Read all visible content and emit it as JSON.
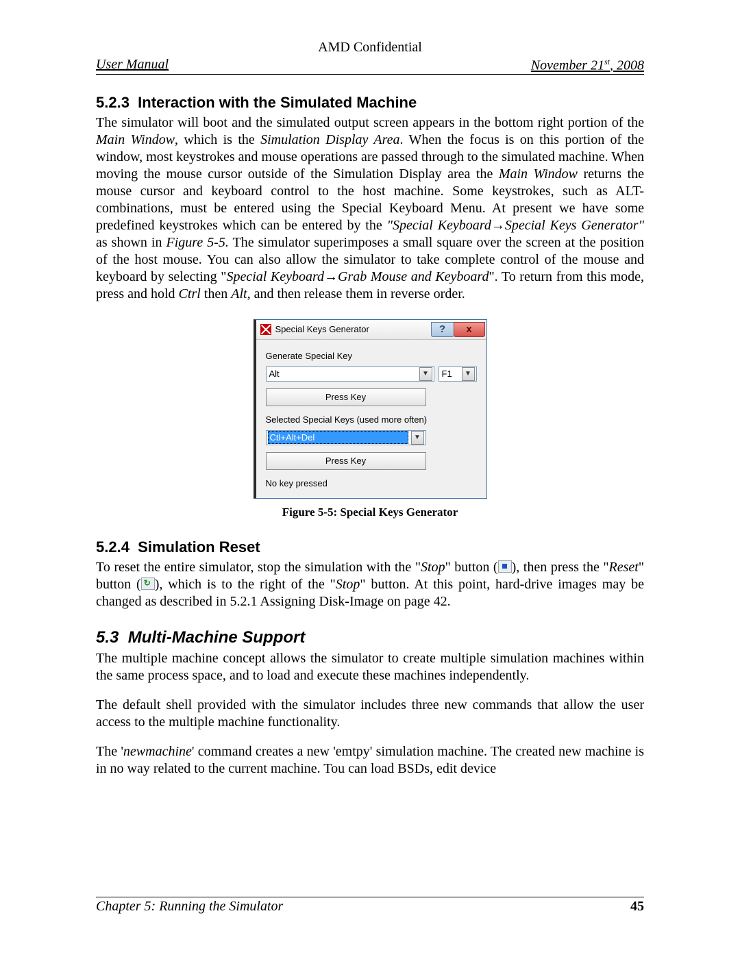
{
  "header": {
    "confidential": "AMD Confidential",
    "left": "User Manual",
    "right_prefix": "November 21",
    "right_sup": "st",
    "right_suffix": ", 2008"
  },
  "sec523": {
    "num": "5.2.3",
    "title": "Interaction with the Simulated Machine",
    "p_a": "The simulator will boot and the simulated output screen appears in the bottom right portion of the ",
    "p_b": "Main Window",
    "p_c": ", which is the ",
    "p_d": "Simulation Display Area",
    "p_e": ". When the focus is on this portion of the window, most keystrokes and mouse operations are passed through to the simulated machine. When moving the mouse cursor outside of the Simulation Display area the ",
    "p_f": "Main Window",
    "p_g": " returns the mouse cursor and keyboard control to the host machine. Some keystrokes, such as ALT-combinations, must be entered using the Special Keyboard Menu. At present we have some predefined keystrokes which can be entered by the ",
    "p_h": "\"Special Keyboard→Special Keys Generator\"",
    "p_i": " as shown in ",
    "p_j": "Figure 5-5.",
    "p_k": " The simulator superimposes a small square over the screen at the position of the host mouse. You can also allow the simulator to take complete control of the mouse and keyboard by selecting \"",
    "p_l": "Special Keyboard→Grab Mouse and Keyboard",
    "p_m": "\". To return from this mode, press and hold ",
    "p_n": "Ctrl",
    "p_o": " then ",
    "p_p": "Alt",
    "p_q": ", and then release them in reverse order."
  },
  "dialog": {
    "title": "Special Keys Generator",
    "help": "?",
    "close": "x",
    "label1": "Generate Special Key",
    "combo1": "Alt",
    "combo1b": "F1",
    "press1": "Press Key",
    "label2": "Selected Special Keys (used more often)",
    "combo2": "Ctl+Alt+Del",
    "press2": "Press Key",
    "status": "No key pressed"
  },
  "figcap": "Figure 5-5: Special  Keys Generator",
  "sec524": {
    "num": "5.2.4",
    "title": "Simulation Reset",
    "p_a": "To reset the entire simulator, stop the simulation with the \"",
    "p_b": "Stop",
    "p_c": "\" button (",
    "p_d": "), then press the \"",
    "p_e": "Reset",
    "p_f": "\" button (",
    "p_g": "), which is to the right of the \"",
    "p_h": "Stop",
    "p_i": "\" button. At this point, hard-drive images may be changed as described in 5.2.1 Assigning Disk-Image on page 42."
  },
  "sec53": {
    "num": "5.3",
    "title": "Multi-Machine Support",
    "p1": "The multiple machine concept allows the simulator to create multiple simulation machines within the same process space, and to load and execute these machines independently.",
    "p2": "The default shell provided with the simulator includes three new commands that allow the user access to the multiple machine functionality.",
    "p3_a": "The '",
    "p3_b": "newmachine",
    "p3_c": "' command creates a new 'emtpy' simulation machine. The created new machine is in no way related to the current machine. Tou can load BSDs, edit device"
  },
  "footer": {
    "left": "Chapter 5: Running the Simulator",
    "page": "45"
  }
}
